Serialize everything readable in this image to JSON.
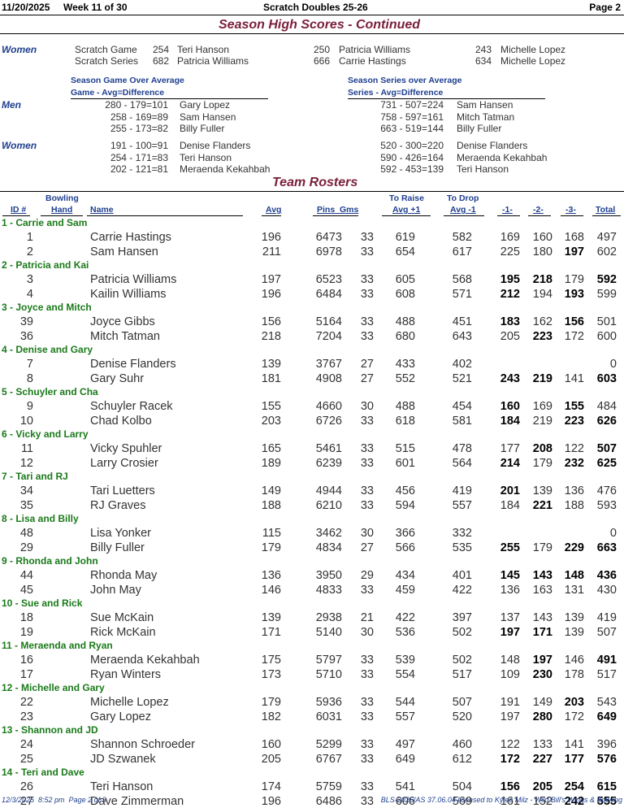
{
  "header": {
    "date": "11/20/2025",
    "week": "Week 11 of 30",
    "league": "Scratch Doubles 25-26",
    "page": "Page 2"
  },
  "season_high": {
    "title": "Season High Scores - Continued",
    "women_label": "Women",
    "rows": [
      {
        "label": "Scratch Game",
        "entries": [
          [
            "254",
            "Teri Hanson"
          ],
          [
            "250",
            "Patricia Williams"
          ],
          [
            "243",
            "Michelle Lopez"
          ]
        ]
      },
      {
        "label": "Scratch Series",
        "entries": [
          [
            "682",
            "Patricia Williams"
          ],
          [
            "666",
            "Carrie Hastings"
          ],
          [
            "634",
            "Michelle Lopez"
          ]
        ]
      }
    ]
  },
  "over_average": {
    "game_title": "Season Game Over Average",
    "game_sub": "Game - Avg=Difference",
    "series_title": "Season Series over Average",
    "series_sub": "Series - Avg=Difference",
    "men_label": "Men",
    "women_label": "Women",
    "men_game": [
      [
        "280 - 179=101",
        "Gary Lopez"
      ],
      [
        "258 - 169=89",
        "Sam Hansen"
      ],
      [
        "255 - 173=82",
        "Billy Fuller"
      ]
    ],
    "men_series": [
      [
        "731 - 507=224",
        "Sam Hansen"
      ],
      [
        "758 - 597=161",
        "Mitch Tatman"
      ],
      [
        "663 - 519=144",
        "Billy Fuller"
      ]
    ],
    "women_game": [
      [
        "191 - 100=91",
        "Denise Flanders"
      ],
      [
        "254 - 171=83",
        "Teri Hanson"
      ],
      [
        "202 - 121=81",
        "Meraenda Kekahbah"
      ]
    ],
    "women_series": [
      [
        "520 - 300=220",
        "Denise Flanders"
      ],
      [
        "590 - 426=164",
        "Meraenda Kekahbah"
      ],
      [
        "592 - 453=139",
        "Teri Hanson"
      ]
    ]
  },
  "rosters": {
    "title": "Team Rosters",
    "columns": {
      "id": "ID #",
      "hand_top": "Bowling",
      "hand": "Hand",
      "name": "Name",
      "avg": "Avg",
      "pins_gms": "Pins  Gms",
      "raise_top": "To Raise",
      "raise": "Avg +1",
      "drop_top": "To Drop",
      "drop": "Avg -1",
      "g1": "-1-",
      "g2": "-2-",
      "g3": "-3-",
      "total": "Total"
    },
    "teams": [
      {
        "name": "1 - Carrie and Sam",
        "players": [
          [
            "1",
            "Carrie Hastings",
            "196",
            "6473",
            "33",
            "619",
            "582",
            "169",
            "160",
            "168",
            "497"
          ],
          [
            "2",
            "Sam Hansen",
            "211",
            "6978",
            "33",
            "654",
            "617",
            "225",
            "180",
            "197",
            "602"
          ]
        ]
      },
      {
        "name": "2 - Patricia and Kai",
        "players": [
          [
            "3",
            "Patricia Williams",
            "197",
            "6523",
            "33",
            "605",
            "568",
            "195",
            "218",
            "179",
            "592"
          ],
          [
            "4",
            "Kailin Williams",
            "196",
            "6484",
            "33",
            "608",
            "571",
            "212",
            "194",
            "193",
            "599"
          ]
        ]
      },
      {
        "name": "3 - Joyce and Mitch",
        "players": [
          [
            "39",
            "Joyce Gibbs",
            "156",
            "5164",
            "33",
            "488",
            "451",
            "183",
            "162",
            "156",
            "501"
          ],
          [
            "36",
            "Mitch Tatman",
            "218",
            "7204",
            "33",
            "680",
            "643",
            "205",
            "223",
            "172",
            "600"
          ]
        ]
      },
      {
        "name": "4 - Denise and Gary",
        "players": [
          [
            "7",
            "Denise Flanders",
            "139",
            "3767",
            "27",
            "433",
            "402",
            "",
            "",
            "",
            "0"
          ],
          [
            "8",
            "Gary Suhr",
            "181",
            "4908",
            "27",
            "552",
            "521",
            "243",
            "219",
            "141",
            "603"
          ]
        ]
      },
      {
        "name": "5 - Schuyler and Cha",
        "players": [
          [
            "9",
            "Schuyler Racek",
            "155",
            "4660",
            "30",
            "488",
            "454",
            "160",
            "169",
            "155",
            "484"
          ],
          [
            "10",
            "Chad Kolbo",
            "203",
            "6726",
            "33",
            "618",
            "581",
            "184",
            "219",
            "223",
            "626"
          ]
        ]
      },
      {
        "name": "6 - Vicky and Larry",
        "players": [
          [
            "11",
            "Vicky Spuhler",
            "165",
            "5461",
            "33",
            "515",
            "478",
            "177",
            "208",
            "122",
            "507"
          ],
          [
            "12",
            "Larry Crosier",
            "189",
            "6239",
            "33",
            "601",
            "564",
            "214",
            "179",
            "232",
            "625"
          ]
        ]
      },
      {
        "name": "7 - Tari and RJ",
        "players": [
          [
            "34",
            "Tari Luetters",
            "149",
            "4944",
            "33",
            "456",
            "419",
            "201",
            "139",
            "136",
            "476"
          ],
          [
            "35",
            "RJ Graves",
            "188",
            "6210",
            "33",
            "594",
            "557",
            "184",
            "221",
            "188",
            "593"
          ]
        ]
      },
      {
        "name": "8 - Lisa and Billy",
        "players": [
          [
            "48",
            "Lisa Yonker",
            "115",
            "3462",
            "30",
            "366",
            "332",
            "",
            "",
            "",
            "0"
          ],
          [
            "29",
            "Billy Fuller",
            "179",
            "4834",
            "27",
            "566",
            "535",
            "255",
            "179",
            "229",
            "663"
          ]
        ]
      },
      {
        "name": "9 - Rhonda and John",
        "players": [
          [
            "44",
            "Rhonda May",
            "136",
            "3950",
            "29",
            "434",
            "401",
            "145",
            "143",
            "148",
            "436"
          ],
          [
            "45",
            "John May",
            "146",
            "4833",
            "33",
            "459",
            "422",
            "136",
            "163",
            "131",
            "430"
          ]
        ]
      },
      {
        "name": "10 - Sue and Rick",
        "players": [
          [
            "18",
            "Sue McKain",
            "139",
            "2938",
            "21",
            "422",
            "397",
            "137",
            "143",
            "139",
            "419"
          ],
          [
            "19",
            "Rick McKain",
            "171",
            "5140",
            "30",
            "536",
            "502",
            "197",
            "171",
            "139",
            "507"
          ]
        ]
      },
      {
        "name": "11 - Meraenda and Ryan",
        "players": [
          [
            "16",
            "Meraenda Kekahbah",
            "175",
            "5797",
            "33",
            "539",
            "502",
            "148",
            "197",
            "146",
            "491"
          ],
          [
            "17",
            "Ryan Winters",
            "173",
            "5710",
            "33",
            "554",
            "517",
            "109",
            "230",
            "178",
            "517"
          ]
        ]
      },
      {
        "name": "12 - Michelle and Gary",
        "players": [
          [
            "22",
            "Michelle Lopez",
            "179",
            "5936",
            "33",
            "544",
            "507",
            "191",
            "149",
            "203",
            "543"
          ],
          [
            "23",
            "Gary Lopez",
            "182",
            "6031",
            "33",
            "557",
            "520",
            "197",
            "280",
            "172",
            "649"
          ]
        ]
      },
      {
        "name": "13 - Shannon and JD",
        "players": [
          [
            "24",
            "Shannon Schroeder",
            "160",
            "5299",
            "33",
            "497",
            "460",
            "122",
            "133",
            "141",
            "396"
          ],
          [
            "25",
            "JD Szwanek",
            "205",
            "6767",
            "33",
            "649",
            "612",
            "172",
            "227",
            "177",
            "576"
          ]
        ]
      },
      {
        "name": "14 - Teri and Dave",
        "players": [
          [
            "26",
            "Teri Hanson",
            "174",
            "5759",
            "33",
            "541",
            "504",
            "156",
            "205",
            "254",
            "615"
          ],
          [
            "27",
            "Dave Zimmerman",
            "196",
            "6486",
            "33",
            "606",
            "569",
            "161",
            "152",
            "242",
            "555"
          ]
        ]
      }
    ],
    "bold_cells": {
      "1-1": [
        9
      ],
      "2-0": [
        7,
        8,
        10
      ],
      "2-1": [
        7,
        9
      ],
      "3-0": [
        7,
        9
      ],
      "3-1": [
        8
      ],
      "4-1": [
        7,
        8,
        10
      ],
      "5-0": [
        7,
        9
      ],
      "5-1": [
        7,
        9,
        10
      ],
      "6-0": [
        8,
        10
      ],
      "6-1": [
        7,
        9,
        10
      ],
      "7-0": [
        7
      ],
      "7-1": [
        8
      ],
      "8-1": [
        7,
        9,
        10
      ],
      "9-0": [
        7,
        8,
        9,
        10
      ],
      "10-1": [
        7,
        8
      ],
      "11-0": [
        8,
        10
      ],
      "11-1": [
        8
      ],
      "12-0": [
        9
      ],
      "12-1": [
        8,
        10
      ],
      "13-1": [
        7,
        8,
        9,
        10
      ],
      "14-0": [
        7,
        8,
        9,
        10
      ],
      "14-1": [
        9,
        10
      ]
    }
  },
  "footer": {
    "left": "12/3/2025  8:52 pm  Page 2 of 3",
    "right": "BLS-2025/AS 37.06.04 licensed to Kylee Milz - Wild Bill's Wings & Bowling"
  }
}
